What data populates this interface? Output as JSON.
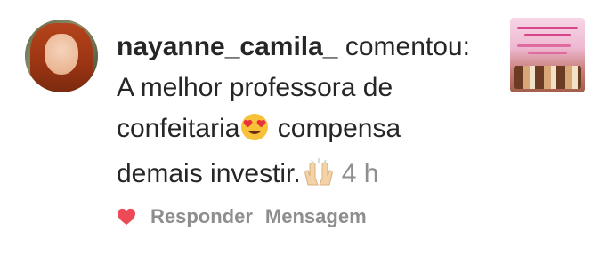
{
  "comment": {
    "username": "nayanne_camila_",
    "action_text": "comentou:",
    "text_part1": "A melhor professora de confeitaria",
    "emoji1": "heart-eyes-emoji",
    "text_part2": " compensa demais investir.",
    "emoji2": "raising-hands-emoji",
    "time": "4 h",
    "reply_label": "Responder",
    "message_label": "Mensagem",
    "colors": {
      "heart": "#ed4956",
      "muted": "#8e8e8e",
      "text": "#262626"
    }
  }
}
